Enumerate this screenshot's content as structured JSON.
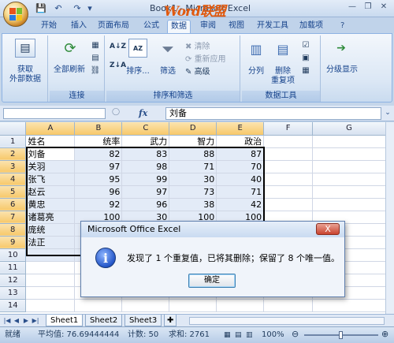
{
  "titlebar": {
    "title": "Book1 - Microsoft Excel",
    "watermark": "Word联盟",
    "watermark_url": "www.wordlm.com",
    "qat": {
      "save": "💾",
      "undo": "↶",
      "redo": "↷",
      "more": "▾"
    }
  },
  "ribbon_tabs": [
    "开始",
    "插入",
    "页面布局",
    "公式",
    "数据",
    "审阅",
    "视图",
    "开发工具",
    "加载项"
  ],
  "active_tab": "数据",
  "ribbon": {
    "get_external": [
      "获取",
      "外部数据"
    ],
    "refresh_all": "全部刷新",
    "group_connections": "连接",
    "sort_az": "A↓Z",
    "sort_btn": "排序...",
    "filter_btn": "筛选",
    "clear": "清除",
    "reapply": "重新应用",
    "advanced": "高级",
    "group_sort": "排序和筛选",
    "text_to_columns": "分列",
    "remove_duplicates": [
      "删除",
      "重复项"
    ],
    "group_data_tools": "数据工具",
    "outline": "分级显示"
  },
  "formula_bar": {
    "name_box": "",
    "fx": "fx",
    "value": "刘备"
  },
  "grid": {
    "columns": [
      "A",
      "B",
      "C",
      "D",
      "E",
      "F",
      "G"
    ],
    "rows": [
      [
        "姓名",
        "统率",
        "武力",
        "智力",
        "政治",
        "",
        ""
      ],
      [
        "刘备",
        "82",
        "83",
        "88",
        "87",
        "",
        ""
      ],
      [
        "关羽",
        "97",
        "98",
        "71",
        "70",
        "",
        ""
      ],
      [
        "张飞",
        "95",
        "99",
        "30",
        "40",
        "",
        ""
      ],
      [
        "赵云",
        "96",
        "97",
        "73",
        "71",
        "",
        ""
      ],
      [
        "黄忠",
        "92",
        "96",
        "38",
        "42",
        "",
        ""
      ],
      [
        "诸葛亮",
        "100",
        "30",
        "100",
        "100",
        "",
        ""
      ],
      [
        "庞统",
        "",
        "",
        "",
        "",
        "",
        ""
      ],
      [
        "法正",
        "",
        "",
        "",
        "",
        "",
        ""
      ],
      [
        "",
        "",
        "",
        "",
        "",
        "",
        ""
      ],
      [
        "",
        "",
        "",
        "",
        "",
        "",
        ""
      ],
      [
        "",
        "",
        "",
        "",
        "",
        "",
        ""
      ],
      [
        "",
        "",
        "",
        "",
        "",
        "",
        ""
      ],
      [
        "",
        "",
        "",
        "",
        "",
        "",
        ""
      ]
    ]
  },
  "sheets": [
    "Sheet1",
    "Sheet2",
    "Sheet3"
  ],
  "status": {
    "mode": "就绪",
    "average": "平均值: 76.69444444",
    "count": "计数: 50",
    "sum": "求和: 2761",
    "zoom": "100%"
  },
  "dialog": {
    "title": "Microsoft Office Excel",
    "close": "X",
    "icon": "i",
    "message": "发现了 1 个重复值，已将其删除；保留了 8 个唯一值。",
    "ok": "确定"
  }
}
